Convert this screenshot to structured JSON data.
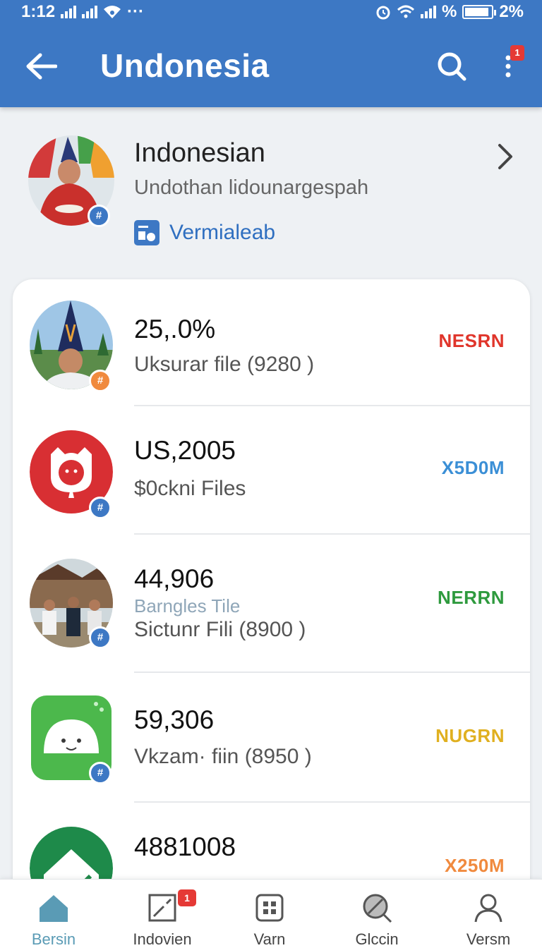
{
  "status_bar": {
    "time": "1:12",
    "overflow": "···",
    "percent_symbol": "%",
    "battery_text": "2%",
    "battery_level": 0.9
  },
  "app_bar": {
    "title": "Undonesia",
    "back_icon": "arrow-left-icon",
    "search_icon": "search-icon",
    "more_icon": "more-vertical-icon",
    "notification_count": "1"
  },
  "profile": {
    "name": "Indonesian",
    "subtitle": "Undothan lidounargespah",
    "link_label": "Vermialeab",
    "badge": "#",
    "badge_color": "#3d78c4"
  },
  "list": [
    {
      "value": "25,.0%",
      "tag": "",
      "detail": "Uksurar file (9280 )",
      "status": "NESRN",
      "status_color": "#e0352b",
      "badge": "#",
      "badge_color": "#f08a3e",
      "avatar": "photo-man-hat"
    },
    {
      "value": "US,2005",
      "tag": "",
      "detail": "$0ckni Files",
      "status": "X5D0M",
      "status_color": "#3b8fd6",
      "badge": "#",
      "badge_color": "#3d78c4",
      "avatar": "red-app-logo"
    },
    {
      "value": "44,906",
      "tag": "Barngles Tile",
      "detail": "Sictunr Fili (8900 )",
      "status": "NERRN",
      "status_color": "#2e9a3e",
      "badge": "#",
      "badge_color": "#3d78c4",
      "avatar": "photo-group"
    },
    {
      "value": "59,306",
      "tag": "",
      "detail": "Vkzam· fiin (8950 )",
      "status": "NUGRN",
      "status_color": "#e0b020",
      "badge": "#",
      "badge_color": "#3d78c4",
      "avatar": "green-chat-logo"
    },
    {
      "value": "4881008",
      "tag": "",
      "detail": "",
      "status": "X250M",
      "status_color": "#f08a3e",
      "badge": "",
      "badge_color": "",
      "avatar": "green-house-logo"
    }
  ],
  "bottom_nav": [
    {
      "label": "Bersin",
      "icon": "home-icon",
      "active": true,
      "badge": ""
    },
    {
      "label": "Indovien",
      "icon": "document-icon",
      "active": false,
      "badge": "1"
    },
    {
      "label": "Varn",
      "icon": "grid-icon",
      "active": false,
      "badge": ""
    },
    {
      "label": "Glccin",
      "icon": "search-slash-icon",
      "active": false,
      "badge": ""
    },
    {
      "label": "Versm",
      "icon": "user-icon",
      "active": false,
      "badge": ""
    }
  ],
  "colors": {
    "primary": "#3d78c4",
    "active_nav": "#5a9bb5"
  }
}
